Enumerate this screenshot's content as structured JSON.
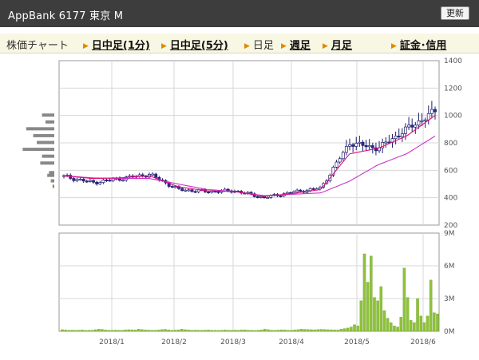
{
  "header": {
    "title": "AppBank  6177  東京 M",
    "refresh_label": "更新"
  },
  "tabs": [
    {
      "label": "株価チャート",
      "style": "plain",
      "arrow": false
    },
    {
      "label": "日中足(1分)",
      "style": "link",
      "arrow": true
    },
    {
      "label": "日中足(5分)",
      "style": "link",
      "arrow": true
    },
    {
      "label": "日足",
      "style": "plain",
      "arrow": true
    },
    {
      "label": "週足",
      "style": "link",
      "arrow": true
    },
    {
      "label": "月足",
      "style": "link",
      "arrow": true
    },
    {
      "label": "証金･信用",
      "style": "link",
      "arrow": true
    }
  ],
  "colors": {
    "accent_arrow": "#e08a00",
    "tab_bg": "#f7f7e3",
    "titlebar_bg": "#3d3d3d",
    "candle_up": "#ffffff",
    "candle_down": "#2b2b9a",
    "ma_short": "#e0107a",
    "ma_long": "#cc33cc",
    "volume_bar": "#8dc23a",
    "volume_profile": "#888888"
  },
  "chart_data": [
    {
      "type": "candlestick",
      "title": "",
      "ylim": [
        200,
        1400
      ],
      "y_ticks": [
        "1400",
        "1200",
        "1000",
        "800",
        "600",
        "400",
        "200"
      ],
      "y_tick_values": [
        1400,
        1200,
        1000,
        800,
        600,
        400,
        200
      ],
      "x_ticks": [
        "2018/1",
        "2018/2",
        "2018/3",
        "2018/4",
        "2018/5",
        "2018/6"
      ],
      "grid": true,
      "legend": "none",
      "series": [
        {
          "series_type": "close_approx",
          "x": [
            "2017/12",
            "2018/1",
            "2018/1",
            "2018/2",
            "2018/2",
            "2018/3",
            "2018/3",
            "2018/4",
            "2018/4",
            "2018/5",
            "2018/5",
            "2018/5",
            "2018/6",
            "2018/6"
          ],
          "values": [
            555,
            510,
            540,
            570,
            460,
            445,
            450,
            400,
            440,
            470,
            800,
            760,
            900,
            1030
          ]
        },
        {
          "series_type": "moving_average_short",
          "values": [
            560,
            540,
            545,
            560,
            480,
            450,
            445,
            410,
            430,
            460,
            720,
            760,
            850,
            1000
          ]
        },
        {
          "series_type": "moving_average_long",
          "values": [
            560,
            545,
            540,
            540,
            500,
            460,
            445,
            415,
            425,
            435,
            520,
            640,
            720,
            850
          ]
        }
      ],
      "volume_profile": [
        {
          "price": 1000,
          "weight": 0.35
        },
        {
          "price": 950,
          "weight": 0.25
        },
        {
          "price": 900,
          "weight": 0.8
        },
        {
          "price": 850,
          "weight": 0.6
        },
        {
          "price": 800,
          "weight": 0.5
        },
        {
          "price": 750,
          "weight": 0.9
        },
        {
          "price": 700,
          "weight": 0.35
        },
        {
          "price": 650,
          "weight": 0.4
        },
        {
          "price": 580,
          "weight": 0.15
        },
        {
          "price": 560,
          "weight": 0.2
        },
        {
          "price": 520,
          "weight": 0.1
        },
        {
          "price": 480,
          "weight": 0.05
        }
      ]
    },
    {
      "type": "bar",
      "title": "",
      "ylim": [
        0,
        9000000
      ],
      "y_ticks": [
        "9M",
        "6M",
        "3M",
        "0M"
      ],
      "y_tick_values": [
        9000000,
        6000000,
        3000000,
        0
      ],
      "x_ticks": [
        "2018/1",
        "2018/2",
        "2018/3",
        "2018/4",
        "2018/5",
        "2018/6"
      ],
      "grid": true,
      "legend": "none",
      "values": [
        150000,
        120000,
        100000,
        110000,
        90000,
        100000,
        120000,
        80000,
        90000,
        100000,
        150000,
        200000,
        180000,
        120000,
        100000,
        90000,
        110000,
        100000,
        90000,
        130000,
        150000,
        140000,
        120000,
        200000,
        160000,
        120000,
        110000,
        100000,
        100000,
        120000,
        160000,
        180000,
        130000,
        100000,
        110000,
        140000,
        200000,
        150000,
        120000,
        100000,
        110000,
        100000,
        90000,
        110000,
        120000,
        100000,
        90000,
        80000,
        100000,
        120000,
        100000,
        90000,
        110000,
        100000,
        120000,
        130000,
        100000,
        90000,
        80000,
        100000,
        120000,
        200000,
        150000,
        100000,
        90000,
        110000,
        130000,
        120000,
        100000,
        90000,
        120000,
        150000,
        200000,
        180000,
        160000,
        150000,
        140000,
        160000,
        180000,
        170000,
        150000,
        140000,
        130000,
        120000,
        200000,
        250000,
        300000,
        400000,
        600000,
        500000,
        2800000,
        7100000,
        4500000,
        6900000,
        3100000,
        2800000,
        4100000,
        1900000,
        1200000,
        800000,
        500000,
        400000,
        1300000,
        5800000,
        3100000,
        1000000,
        800000,
        3000000,
        1400000,
        800000,
        1400000,
        4700000,
        1700000,
        1600000
      ]
    }
  ]
}
